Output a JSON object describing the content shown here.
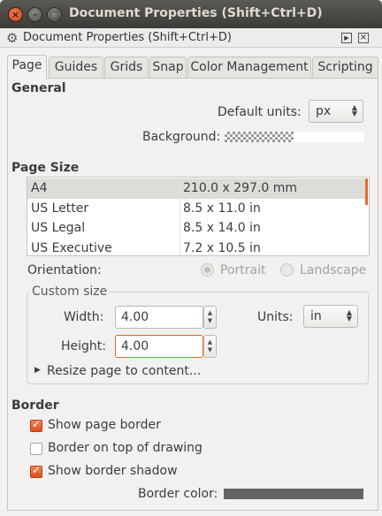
{
  "window": {
    "title": "Document Properties (Shift+Ctrl+D)",
    "close_glyph": "×",
    "min_glyph": "–",
    "max_glyph": "□"
  },
  "dock": {
    "title": "Document Properties (Shift+Ctrl+D)",
    "icon": "gear-icon",
    "icon_glyph": "⚙",
    "float_glyph": "▶",
    "close_glyph": "×"
  },
  "tabs": [
    "Page",
    "Guides",
    "Grids",
    "Snap",
    "Color Management",
    "Scripting"
  ],
  "active_tab": "Page",
  "general": {
    "heading": "General",
    "default_units_label": "Default units:",
    "default_units_value": "px",
    "background_label": "Background:"
  },
  "page_size": {
    "heading": "Page Size",
    "rows": [
      {
        "name": "A4",
        "size": "210.0 x 297.0 mm"
      },
      {
        "name": "US Letter",
        "size": "8.5 x 11.0 in"
      },
      {
        "name": "US Legal",
        "size": "8.5 x 14.0 in"
      },
      {
        "name": "US Executive",
        "size": "7.2 x 10.5 in"
      }
    ],
    "selected_row": 0,
    "orientation_label": "Orientation:",
    "portrait_label": "Portrait",
    "landscape_label": "Landscape"
  },
  "custom_size": {
    "title": "Custom size",
    "width_label": "Width:",
    "width_value": "4.00",
    "height_label": "Height:",
    "height_value": "4.00",
    "units_label": "Units:",
    "units_value": "in",
    "resize_label": "Resize page to content..."
  },
  "border": {
    "heading": "Border",
    "show_page_border": {
      "label": "Show page border",
      "checked": true
    },
    "border_on_top": {
      "label": "Border on top of drawing",
      "checked": false
    },
    "show_border_shadow": {
      "label": "Show border shadow",
      "checked": true
    },
    "border_color_label": "Border color:",
    "border_color": "#646464"
  },
  "colors": {
    "accent": "#e06a2c",
    "titlebar": "#3c3b37"
  }
}
